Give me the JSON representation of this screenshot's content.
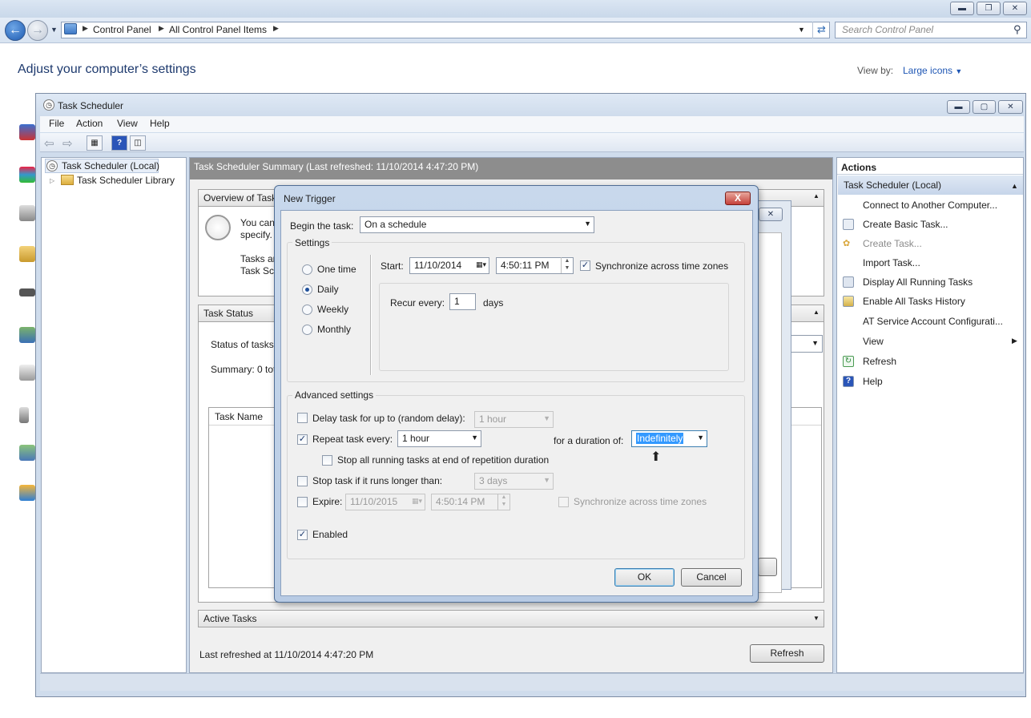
{
  "cp": {
    "breadcrumb": [
      "Control Panel",
      "All Control Panel Items"
    ],
    "search_placeholder": "Search Control Panel",
    "heading": "Adjust your computer’s settings",
    "view_by_label": "View by:",
    "view_by_value": "Large icons"
  },
  "ts": {
    "title": "Task Scheduler",
    "menu": [
      "File",
      "Action",
      "View",
      "Help"
    ],
    "tree": {
      "root": "Task Scheduler (Local)",
      "child": "Task Scheduler Library"
    },
    "center": {
      "header": "Task Scheduler Summary (Last refreshed: 11/10/2014 4:47:20 PM)",
      "overview_title": "Overview of Task",
      "overview_text1": "You can",
      "overview_text2": "specify.",
      "overview_text3": "Tasks ar",
      "overview_text4": "Task Sch",
      "task_status_title": "Task Status",
      "status_of_tasks": "Status of tasks t",
      "summary_text": "Summary: 0 tot",
      "task_name_col": "Task Name",
      "active_tasks_title": "Active Tasks",
      "last_refreshed": "Last refreshed at 11/10/2014 4:47:20 PM",
      "refresh_button": "Refresh"
    },
    "actions": {
      "header": "Actions",
      "subheader": "Task Scheduler (Local)",
      "items": [
        "Connect to Another Computer...",
        "Create Basic Task...",
        "Create Task...",
        "Import Task...",
        "Display All Running Tasks",
        "Enable All Tasks History",
        "AT Service Account Configurati...",
        "View",
        "Refresh",
        "Help"
      ]
    }
  },
  "trigger": {
    "title": "New Trigger",
    "close": "X",
    "begin_label": "Begin the task:",
    "begin_value": "On a schedule",
    "settings_label": "Settings",
    "radios": [
      "One time",
      "Daily",
      "Weekly",
      "Monthly"
    ],
    "selected_radio": "Daily",
    "start_label": "Start:",
    "start_date": "11/10/2014",
    "start_time": "4:50:11 PM",
    "sync_label": "Synchronize across time zones",
    "recur_label": "Recur every:",
    "recur_value": "1",
    "recur_unit": "days",
    "advanced_label": "Advanced settings",
    "delay_label": "Delay task for up to (random delay):",
    "delay_value": "1 hour",
    "repeat_label": "Repeat task every:",
    "repeat_value": "1 hour",
    "duration_label": "for a duration of:",
    "duration_value": "Indefinitely",
    "stop_all_label": "Stop all running tasks at end of repetition duration",
    "stop_longer_label": "Stop task if it runs longer than:",
    "stop_longer_value": "3 days",
    "expire_label": "Expire:",
    "expire_date": "11/10/2015",
    "expire_time": "4:50:14 PM",
    "expire_sync_label": "Synchronize across time zones",
    "enabled_label": "Enabled",
    "ok": "OK",
    "cancel": "Cancel"
  }
}
